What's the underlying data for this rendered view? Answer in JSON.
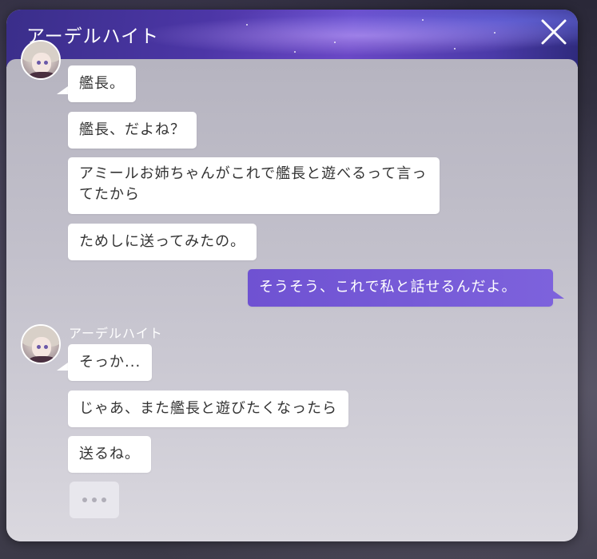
{
  "window": {
    "title": "アーデルハイト"
  },
  "messages": [
    {
      "text": "艦長。"
    },
    {
      "text": "艦長、だよね？"
    },
    {
      "text": "アミールお姉ちゃんがこれで艦長と遊べるって言ってたから"
    },
    {
      "text": "ためしに送ってみたの。"
    },
    {
      "text": "そうそう、これで私と話せるんだよ。"
    },
    {
      "sender": "アーデルハイト"
    },
    {
      "text": "そっか..."
    },
    {
      "text": "じゃあ、また艦長と遊びたくなったら"
    },
    {
      "text": "送るね。"
    }
  ],
  "colors": {
    "accent": "#6f52d2",
    "title_bar": "#4c36a6",
    "bubble": "#ffffff"
  },
  "icons": {
    "close": "close-icon",
    "typing": "typing-indicator"
  }
}
